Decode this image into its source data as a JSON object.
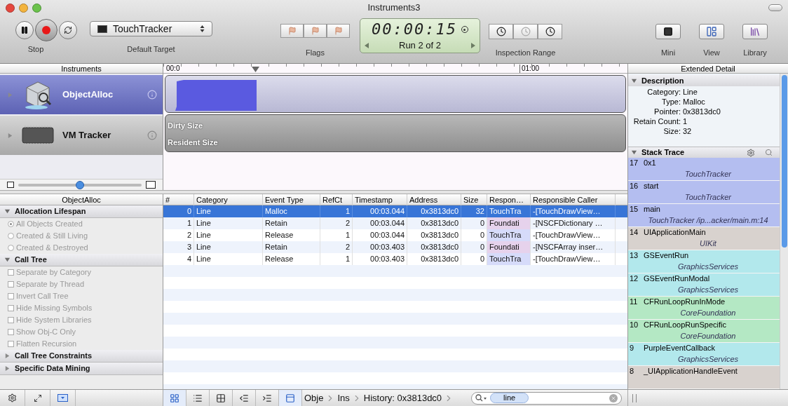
{
  "window": {
    "title": "Instruments3"
  },
  "toolbar": {
    "record": {
      "on": true
    },
    "record_label": "Stop",
    "target": {
      "value": "TouchTracker",
      "label": "Default Target"
    },
    "flags_label": "Flags",
    "timer": {
      "time": "00:00:15",
      "run": "Run 2 of 2"
    },
    "inspection_label": "Inspection Range",
    "right_buttons": [
      {
        "kind": "mini",
        "label": "Mini"
      },
      {
        "kind": "view",
        "label": "View"
      },
      {
        "kind": "library",
        "label": "Library"
      }
    ]
  },
  "instruments": {
    "header": "Instruments",
    "items": [
      {
        "kind": "alloc",
        "name": "ObjectAlloc",
        "selected": true
      },
      {
        "kind": "vm",
        "name": "VM Tracker",
        "selected": false
      }
    ],
    "zoom": {
      "level": 0.5
    }
  },
  "timeline": {
    "ticks": [
      "00:0",
      "01:00"
    ],
    "vm_labels": [
      "Dirty Size",
      "Resident Size"
    ]
  },
  "settings": {
    "header": "ObjectAlloc",
    "sections": [
      {
        "title": "Allocation Lifespan",
        "expanded": true,
        "options": [
          {
            "kind": "radio",
            "label": "All Objects Created",
            "selected": true
          },
          {
            "kind": "radio",
            "label": "Created & Still Living",
            "selected": false
          },
          {
            "kind": "radio",
            "label": "Created & Destroyed",
            "selected": false
          }
        ]
      },
      {
        "title": "Call Tree",
        "expanded": true,
        "options": [
          {
            "kind": "checkbox",
            "label": "Separate by Category",
            "checked": false
          },
          {
            "kind": "checkbox",
            "label": "Separate by Thread",
            "checked": false
          },
          {
            "kind": "checkbox",
            "label": "Invert Call Tree",
            "checked": false
          },
          {
            "kind": "checkbox",
            "label": "Hide Missing Symbols",
            "checked": false
          },
          {
            "kind": "checkbox",
            "label": "Hide System Libraries",
            "checked": false
          },
          {
            "kind": "checkbox",
            "label": "Show Obj-C Only",
            "checked": false
          },
          {
            "kind": "checkbox",
            "label": "Flatten Recursion",
            "checked": false
          }
        ]
      },
      {
        "title": "Call Tree Constraints",
        "expanded": false
      },
      {
        "title": "Specific Data Mining",
        "expanded": false
      }
    ]
  },
  "table": {
    "columns": [
      "#",
      "Category",
      "Event Type",
      "RefCt",
      "Timestamp",
      "Address",
      "Size",
      "Respon…",
      "Responsible Caller"
    ],
    "rows": [
      {
        "cells": [
          "0",
          "Line",
          "Malloc",
          "1",
          "00:03.044",
          "0x3813dc0",
          "32",
          "TouchTra",
          "-[TouchDrawView…"
        ],
        "selected": true
      },
      {
        "cells": [
          "1",
          "Line",
          "Retain",
          "2",
          "00:03.044",
          "0x3813dc0",
          "0",
          "Foundati",
          "-[NSCFDictionary …"
        ],
        "selected": false,
        "color": "#e6d2ec"
      },
      {
        "cells": [
          "2",
          "Line",
          "Release",
          "1",
          "00:03.044",
          "0x3813dc0",
          "0",
          "TouchTra",
          "-[TouchDrawView…"
        ],
        "selected": false,
        "color": "#d6dbfa"
      },
      {
        "cells": [
          "3",
          "Line",
          "Retain",
          "2",
          "00:03.403",
          "0x3813dc0",
          "0",
          "Foundati",
          "-[NSCFArray inser…"
        ],
        "selected": false,
        "color": "#e6d2ec"
      },
      {
        "cells": [
          "4",
          "Line",
          "Release",
          "1",
          "00:03.403",
          "0x3813dc0",
          "0",
          "TouchTra",
          "-[TouchDrawView…"
        ],
        "selected": false,
        "color": "#d6dbfa"
      }
    ]
  },
  "extended_detail": {
    "header": "Extended Detail",
    "description": {
      "title": "Description",
      "fields": [
        {
          "label": "Category:",
          "value": "Line"
        },
        {
          "label": "Type:",
          "value": "Malloc"
        },
        {
          "label": "Pointer:",
          "value": "0x3813dc0"
        },
        {
          "label": "Retain Count:",
          "value": "1"
        },
        {
          "label": "Size:",
          "value": "32"
        }
      ]
    },
    "stack_trace": {
      "title": "Stack Trace",
      "frames": [
        {
          "index": "17",
          "symbol": "0x1",
          "library": "TouchTracker",
          "color": "#b4bef0"
        },
        {
          "index": "16",
          "symbol": "start",
          "library": "TouchTracker",
          "color": "#b4bef0"
        },
        {
          "index": "15",
          "symbol": "main",
          "library": "TouchTracker /ip...acker/main.m:14",
          "color": "#b4bef0"
        },
        {
          "index": "14",
          "symbol": "UIApplicationMain",
          "library": "UIKit",
          "color": "#d8d2ce"
        },
        {
          "index": "13",
          "symbol": "GSEventRun",
          "library": "GraphicsServices",
          "color": "#b2e8ec"
        },
        {
          "index": "12",
          "symbol": "GSEventRunModal",
          "library": "GraphicsServices",
          "color": "#b2e8ec"
        },
        {
          "index": "11",
          "symbol": "CFRunLoopRunInMode",
          "library": "CoreFoundation",
          "color": "#b4e8c4"
        },
        {
          "index": "10",
          "symbol": "CFRunLoopRunSpecific",
          "library": "CoreFoundation",
          "color": "#b4e8c4"
        },
        {
          "index": "9",
          "symbol": "PurpleEventCallback",
          "library": "GraphicsServices",
          "color": "#b2e8ec"
        },
        {
          "index": "8",
          "symbol": "_UIApplicationHandleEvent",
          "color": "#d8d2ce"
        }
      ]
    }
  },
  "bottom_bar": {
    "view_modes": [
      {
        "kind": "grid",
        "selected": true
      },
      {
        "kind": "list",
        "selected": false
      },
      {
        "kind": "blocks",
        "selected": false
      },
      {
        "kind": "outdent",
        "selected": false
      },
      {
        "kind": "indent",
        "selected": false
      },
      {
        "kind": "panel",
        "selected": true
      }
    ],
    "breadcrumbs": [
      "Obje",
      "Ins",
      "History: 0x3813dc0"
    ],
    "search": {
      "value": "line"
    }
  }
}
